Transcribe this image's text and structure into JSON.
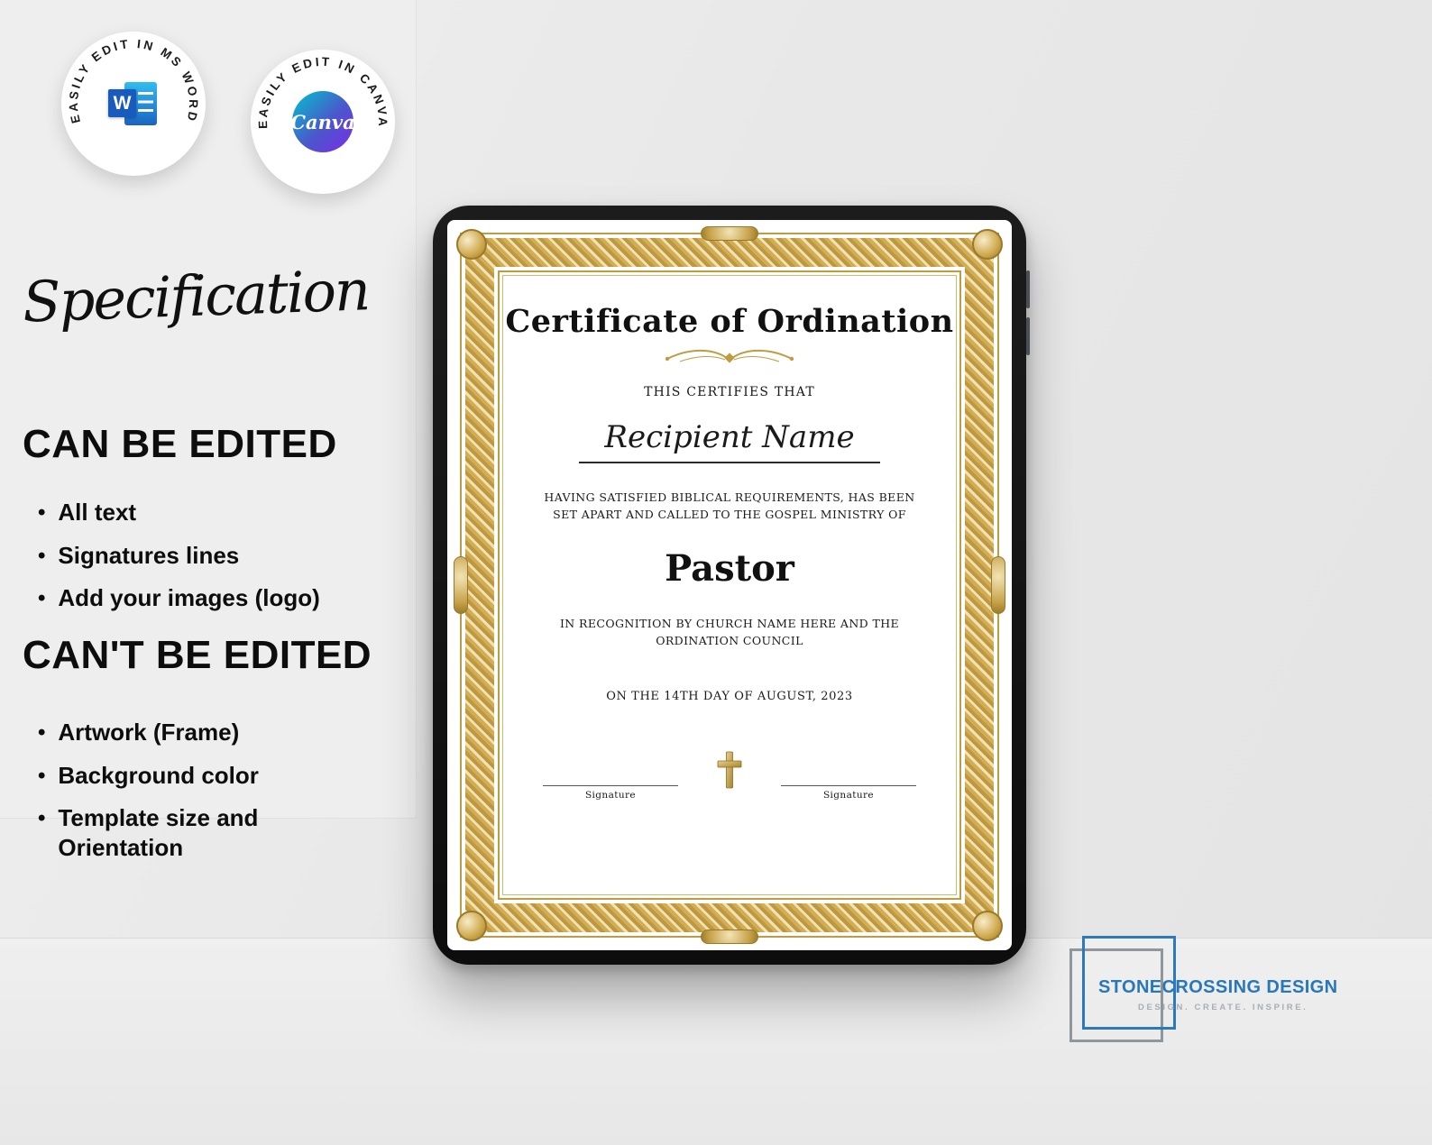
{
  "badges": {
    "word": {
      "ring_text": "EASILY EDIT IN MS WORD",
      "logo_letter": "W"
    },
    "canva": {
      "ring_text": "EASILY EDIT IN CANVA",
      "logo_text": "Canva"
    }
  },
  "specification": {
    "title": "Specification",
    "can_edit": {
      "heading": "CAN BE EDITED",
      "items": [
        "All text",
        "Signatures lines",
        "Add your images (logo)"
      ]
    },
    "cant_edit": {
      "heading": "CAN'T BE EDITED",
      "items": [
        "Artwork (Frame)",
        "Background color",
        "Template size and Orientation"
      ]
    }
  },
  "certificate": {
    "title": "Certificate of Ordination",
    "certifies": "THIS CERTIFIES THAT",
    "recipient": "Recipient Name",
    "body1": "HAVING SATISFIED BIBLICAL REQUIREMENTS, HAS BEEN SET APART AND CALLED TO THE GOSPEL MINISTRY OF",
    "role": "Pastor",
    "body2": "IN RECOGNITION BY CHURCH NAME HERE AND THE ORDINATION COUNCIL",
    "date_line": "ON THE 14TH DAY OF AUGUST, 2023",
    "signature_left": "Signature",
    "signature_right": "Signature"
  },
  "brand": {
    "name": "STONECROSSING DESIGN",
    "tagline": "DESIGN. CREATE. INSPIRE."
  },
  "colors": {
    "gold": "#bf9c42",
    "brand_blue": "#2878b8",
    "word_blue": "#185abd"
  }
}
